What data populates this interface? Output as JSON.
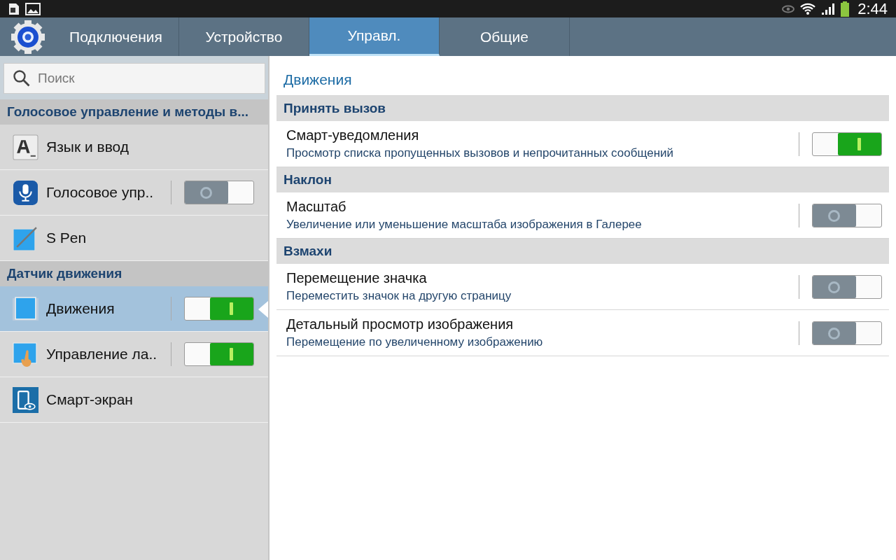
{
  "status_bar": {
    "time": "2:44"
  },
  "tabs": [
    {
      "label": "Подключения",
      "selected": false
    },
    {
      "label": "Устройство",
      "selected": false
    },
    {
      "label": "Управл.",
      "selected": true
    },
    {
      "label": "Общие",
      "selected": false
    }
  ],
  "search": {
    "placeholder": "Поиск"
  },
  "sidebar": {
    "items": [
      {
        "kind": "header",
        "label": "Голосовое управление и методы в..."
      },
      {
        "kind": "item",
        "label": "Язык и ввод",
        "selected": false
      },
      {
        "kind": "item",
        "label": "Голосовое упр..",
        "selected": false,
        "on": false
      },
      {
        "kind": "item",
        "label": "S Pen",
        "selected": false
      },
      {
        "kind": "header",
        "label": "Датчик движения"
      },
      {
        "kind": "item",
        "label": "Движения",
        "selected": true,
        "on": true
      },
      {
        "kind": "item",
        "label": "Управление ла..",
        "selected": false,
        "on": true
      },
      {
        "kind": "item",
        "label": "Смарт-экран",
        "selected": false
      }
    ]
  },
  "content": {
    "title": "Движения",
    "sections": [
      {
        "title": "Принять вызов",
        "rows": [
          {
            "title": "Смарт-уведомления",
            "description": "Просмотр списка пропущенных вызовов и непрочитанных сообщений",
            "on": true
          }
        ]
      },
      {
        "title": "Наклон",
        "rows": [
          {
            "title": "Масштаб",
            "description": "Увеличение или уменьшение масштаба изображения в Галерее",
            "on": false
          }
        ]
      },
      {
        "title": "Взмахи",
        "rows": [
          {
            "title": "Перемещение значка",
            "description": "Переместить значок на другую страницу",
            "on": false
          },
          {
            "title": "Детальный просмотр изображения",
            "description": "Перемещение по увеличенному изображению",
            "on": false
          }
        ]
      }
    ]
  }
}
